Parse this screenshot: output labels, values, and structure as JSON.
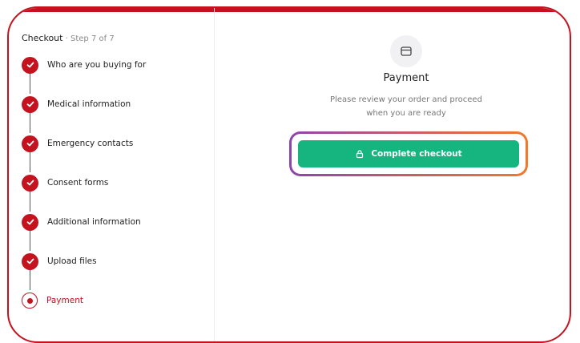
{
  "sidebar": {
    "title": "Checkout",
    "separator": " · ",
    "step_text": "Step 7 of 7",
    "items": [
      {
        "label": "Who are you buying for",
        "state": "complete"
      },
      {
        "label": "Medical information",
        "state": "complete"
      },
      {
        "label": "Emergency contacts",
        "state": "complete"
      },
      {
        "label": "Consent forms",
        "state": "complete"
      },
      {
        "label": "Additional information",
        "state": "complete"
      },
      {
        "label": "Upload files",
        "state": "complete"
      },
      {
        "label": "Payment",
        "state": "current"
      }
    ]
  },
  "main": {
    "icon": "card-icon",
    "title": "Payment",
    "description": "Please review your order and proceed when you are ready",
    "cta_label": "Complete checkout",
    "cta_icon": "lock-icon"
  },
  "colors": {
    "accent": "#c4121f",
    "cta": "#16b57f",
    "highlight_start": "#8e44ad",
    "highlight_end": "#f07a2c"
  }
}
